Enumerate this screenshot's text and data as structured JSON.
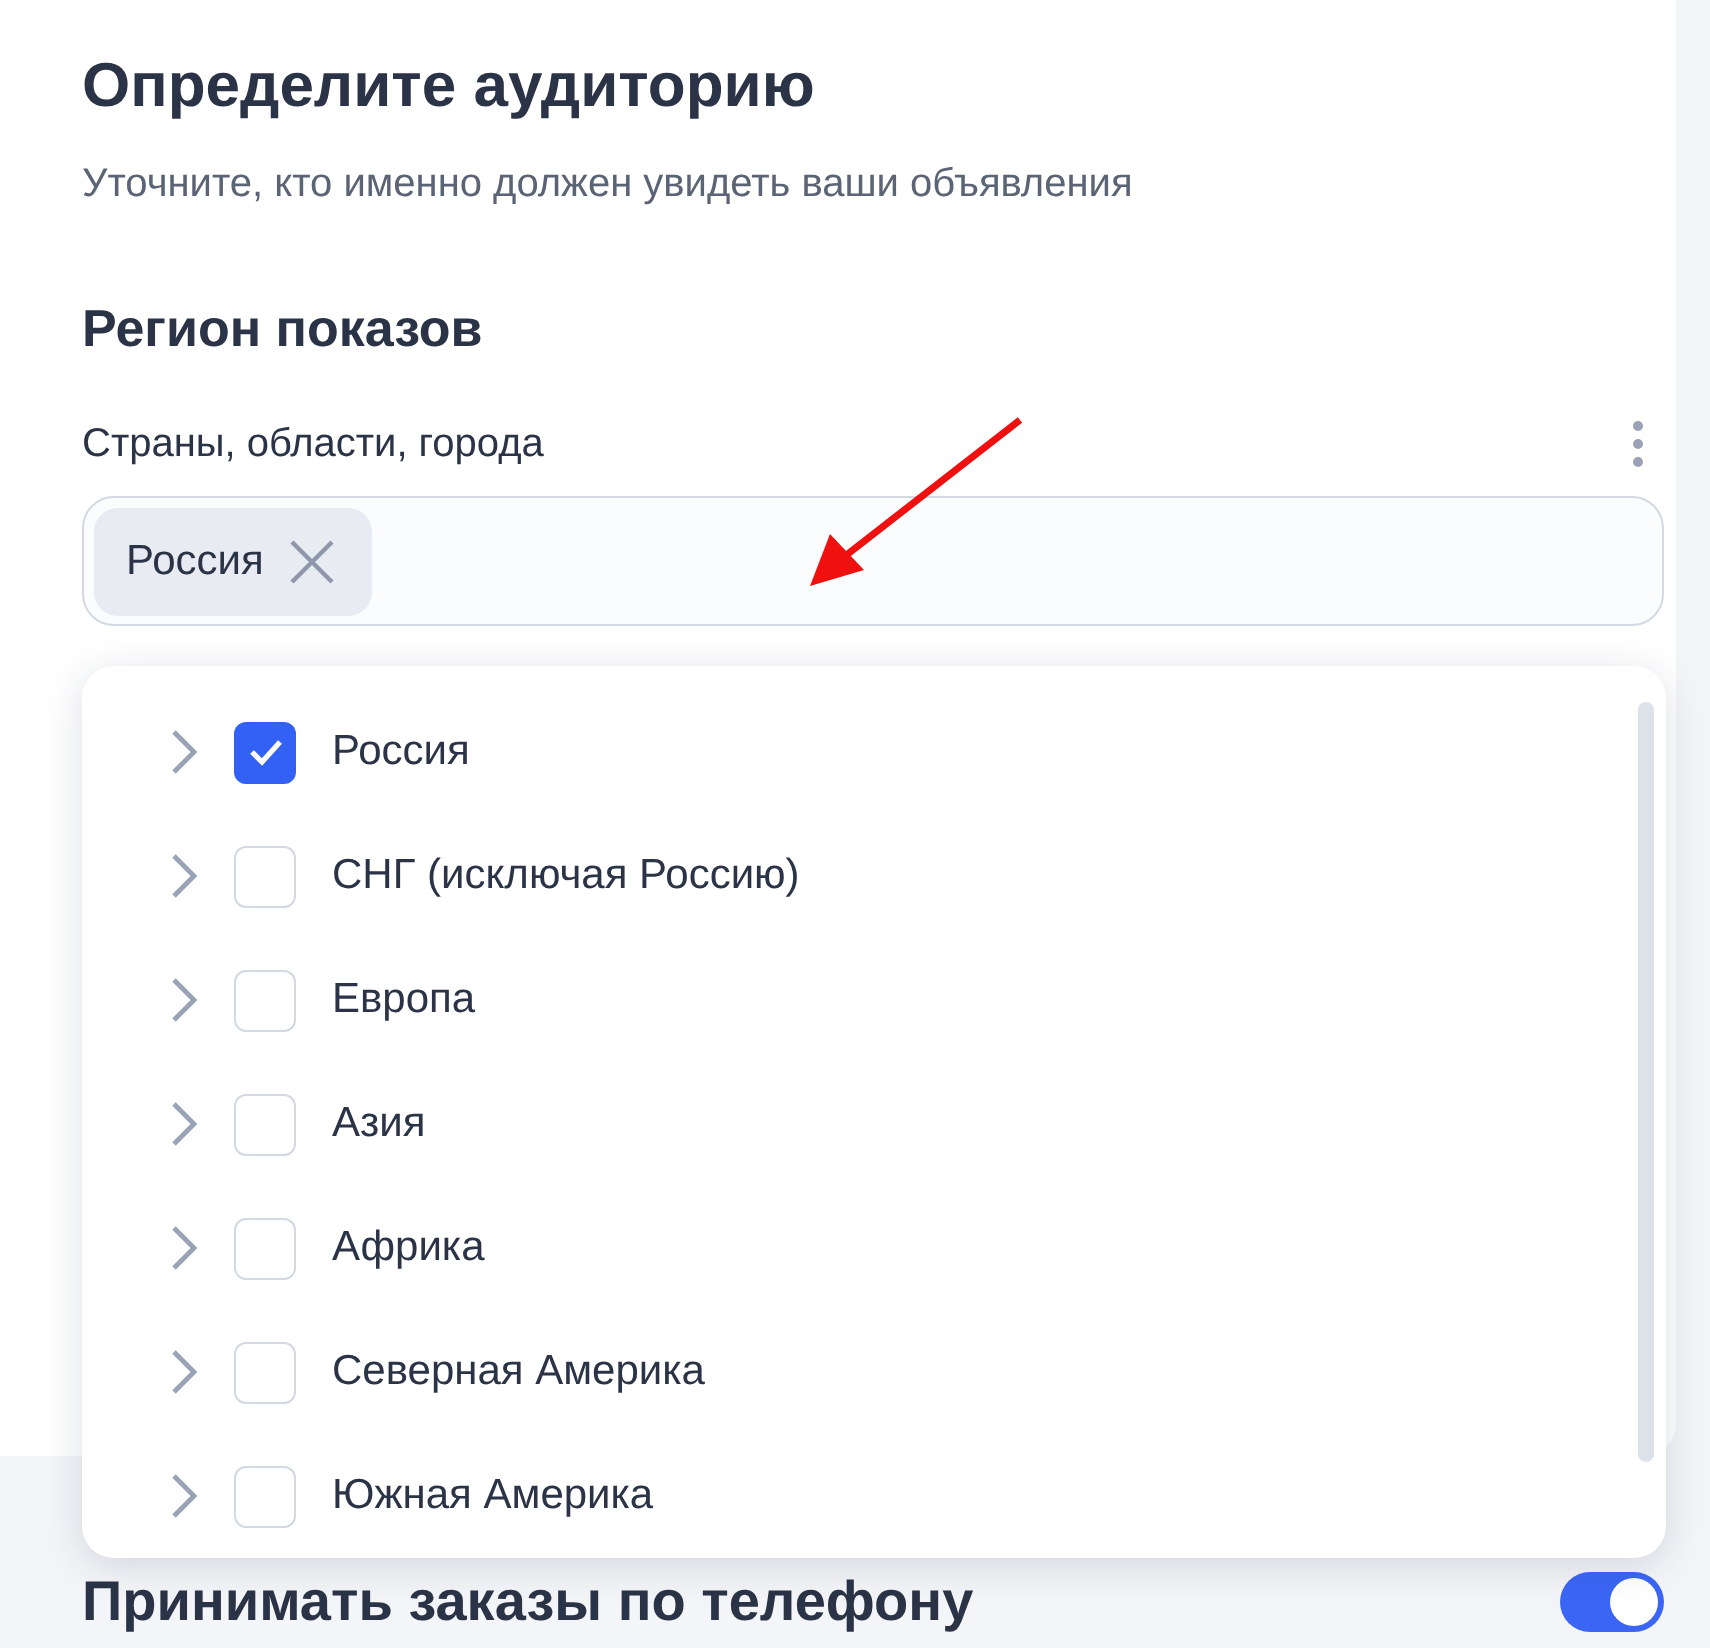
{
  "title": "Определите аудиторию",
  "subtitle": "Уточните, кто именно должен увидеть ваши объявления",
  "region": {
    "heading": "Регион показов",
    "field_label": "Страны, области, города",
    "chips": [
      {
        "label": "Россия"
      }
    ],
    "dropdown": [
      {
        "label": "Россия",
        "checked": true
      },
      {
        "label": "СНГ (исключая Россию)",
        "checked": false
      },
      {
        "label": "Европа",
        "checked": false
      },
      {
        "label": "Азия",
        "checked": false
      },
      {
        "label": "Африка",
        "checked": false
      },
      {
        "label": "Северная Америка",
        "checked": false
      },
      {
        "label": "Южная Америка",
        "checked": false
      }
    ]
  },
  "phone_orders": {
    "label": "Принимать заказы по телефону",
    "on": true
  }
}
